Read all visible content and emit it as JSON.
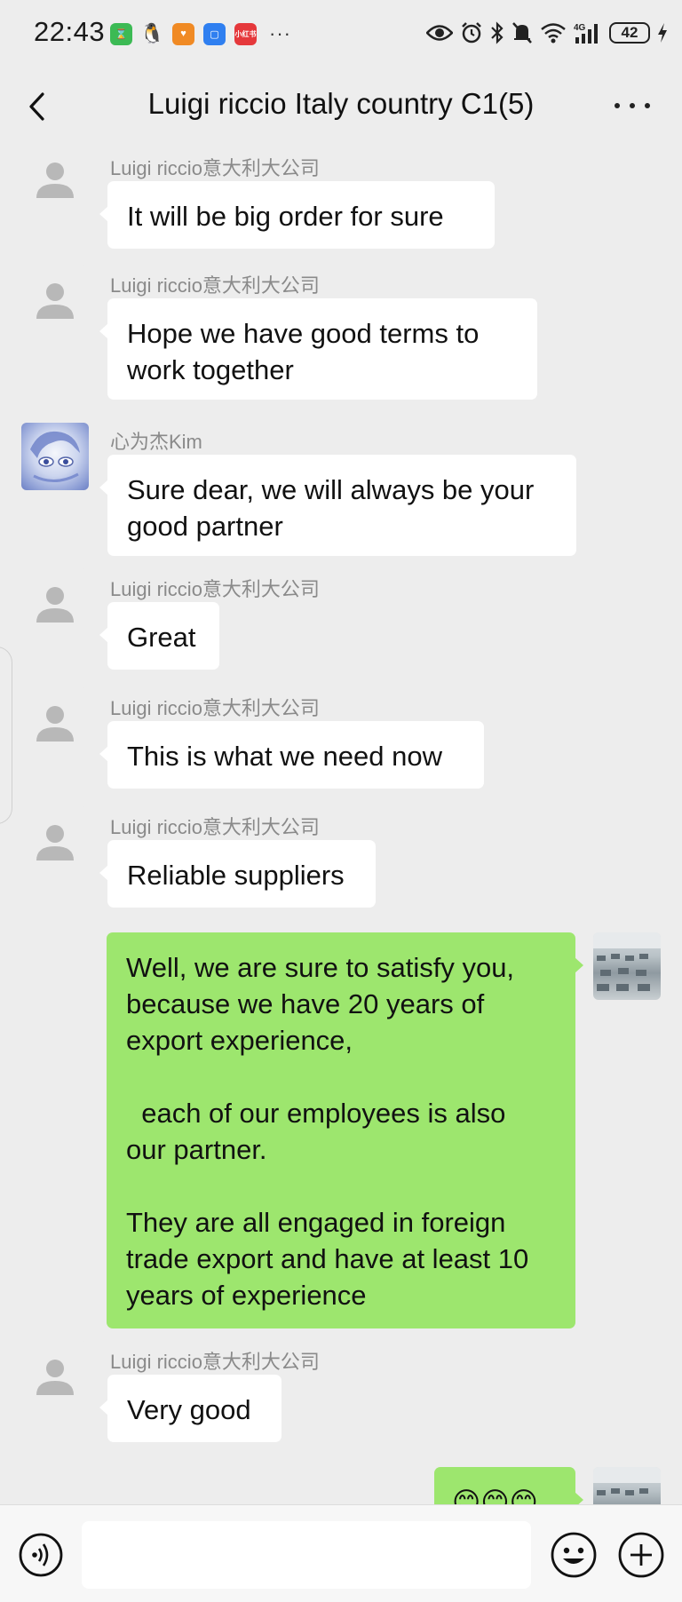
{
  "status_bar": {
    "time": "22:43",
    "network": "4G",
    "battery": "42",
    "more": "···"
  },
  "header": {
    "title": "Luigi riccio Italy country C1(5)"
  },
  "messages": [
    {
      "sender": "Luigi riccio意大利大公司",
      "lines": [
        "It will be big order for sure"
      ]
    },
    {
      "sender": "Luigi riccio意大利大公司",
      "lines": [
        "Hope we have good terms to",
        "work together"
      ]
    },
    {
      "sender": "心为杰Kim",
      "lines": [
        "Sure dear, we will always be your",
        "good partner"
      ]
    },
    {
      "sender": "Luigi riccio意大利大公司",
      "lines": [
        "Great"
      ]
    },
    {
      "sender": "Luigi riccio意大利大公司",
      "lines": [
        "This is what we need now"
      ]
    },
    {
      "sender": "Luigi riccio意大利大公司",
      "lines": [
        "Reliable suppliers"
      ]
    },
    {
      "sender": "",
      "lines": [
        "Well, we are sure to satisfy you,",
        "because we have 20 years of",
        "export experience,",
        "",
        "  each of our employees is also",
        "our partner.",
        "",
        "They are all engaged in foreign",
        "trade export and have at least 10",
        "years of experience"
      ]
    },
    {
      "sender": "Luigi riccio意大利大公司",
      "lines": [
        "Very good"
      ]
    },
    {
      "sender": "",
      "lines": [
        "😊😊😊"
      ]
    }
  ],
  "colors": {
    "background": "#ededed",
    "bubble_other": "#ffffff",
    "bubble_mine": "#9de66e",
    "sender_name": "#8a8a8a"
  }
}
